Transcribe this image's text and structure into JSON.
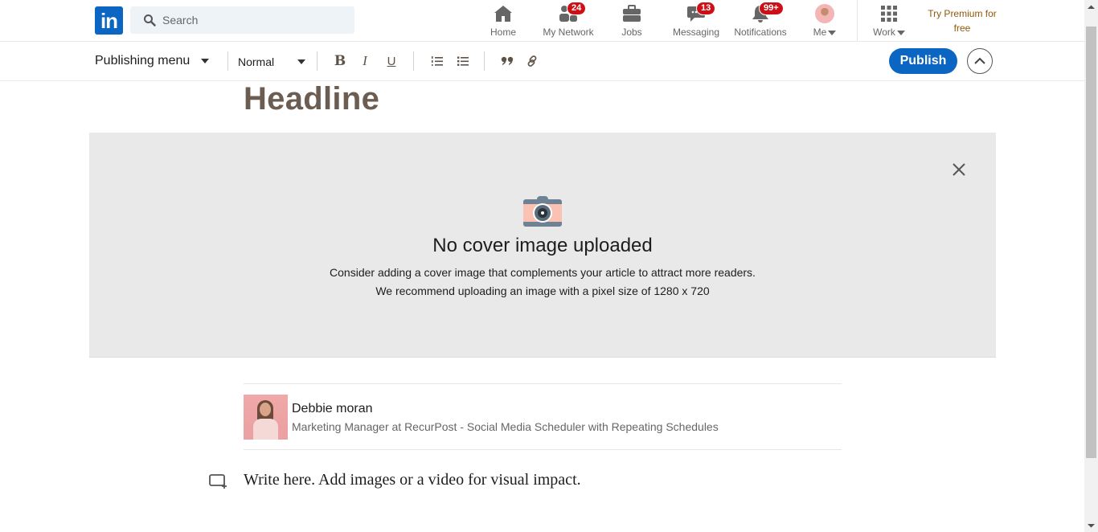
{
  "nav": {
    "logo_text": "in",
    "search_placeholder": "Search",
    "items": [
      {
        "label": "Home",
        "icon": "home-icon",
        "badge": null
      },
      {
        "label": "My Network",
        "icon": "network-icon",
        "badge": "24"
      },
      {
        "label": "Jobs",
        "icon": "briefcase-icon",
        "badge": null
      },
      {
        "label": "Messaging",
        "icon": "messaging-icon",
        "badge": "13"
      },
      {
        "label": "Notifications",
        "icon": "bell-icon",
        "badge": "99+"
      },
      {
        "label": "Me",
        "icon": "avatar",
        "badge": null
      }
    ],
    "work_label": "Work",
    "premium_line1": "Try Premium for",
    "premium_line2": "free"
  },
  "toolbar": {
    "publishing_menu": "Publishing menu",
    "text_style": "Normal",
    "bold": "B",
    "italic": "I",
    "underline": "U",
    "publish_label": "Publish"
  },
  "article": {
    "headline_placeholder": "Headline",
    "cover": {
      "title": "No cover image uploaded",
      "line1": "Consider adding a cover image that complements your article to attract more readers.",
      "line2": "We recommend uploading an image with a pixel size of 1280 x 720"
    },
    "author": {
      "name": "Debbie moran",
      "title": "Marketing Manager at RecurPost - Social Media Scheduler with Repeating Schedules"
    },
    "body_placeholder": "Write here. Add images or a video for visual impact."
  },
  "colors": {
    "brand": "#0a66c2",
    "badge": "#cc1016",
    "premium": "#915907",
    "headline": "#6b5d52"
  }
}
